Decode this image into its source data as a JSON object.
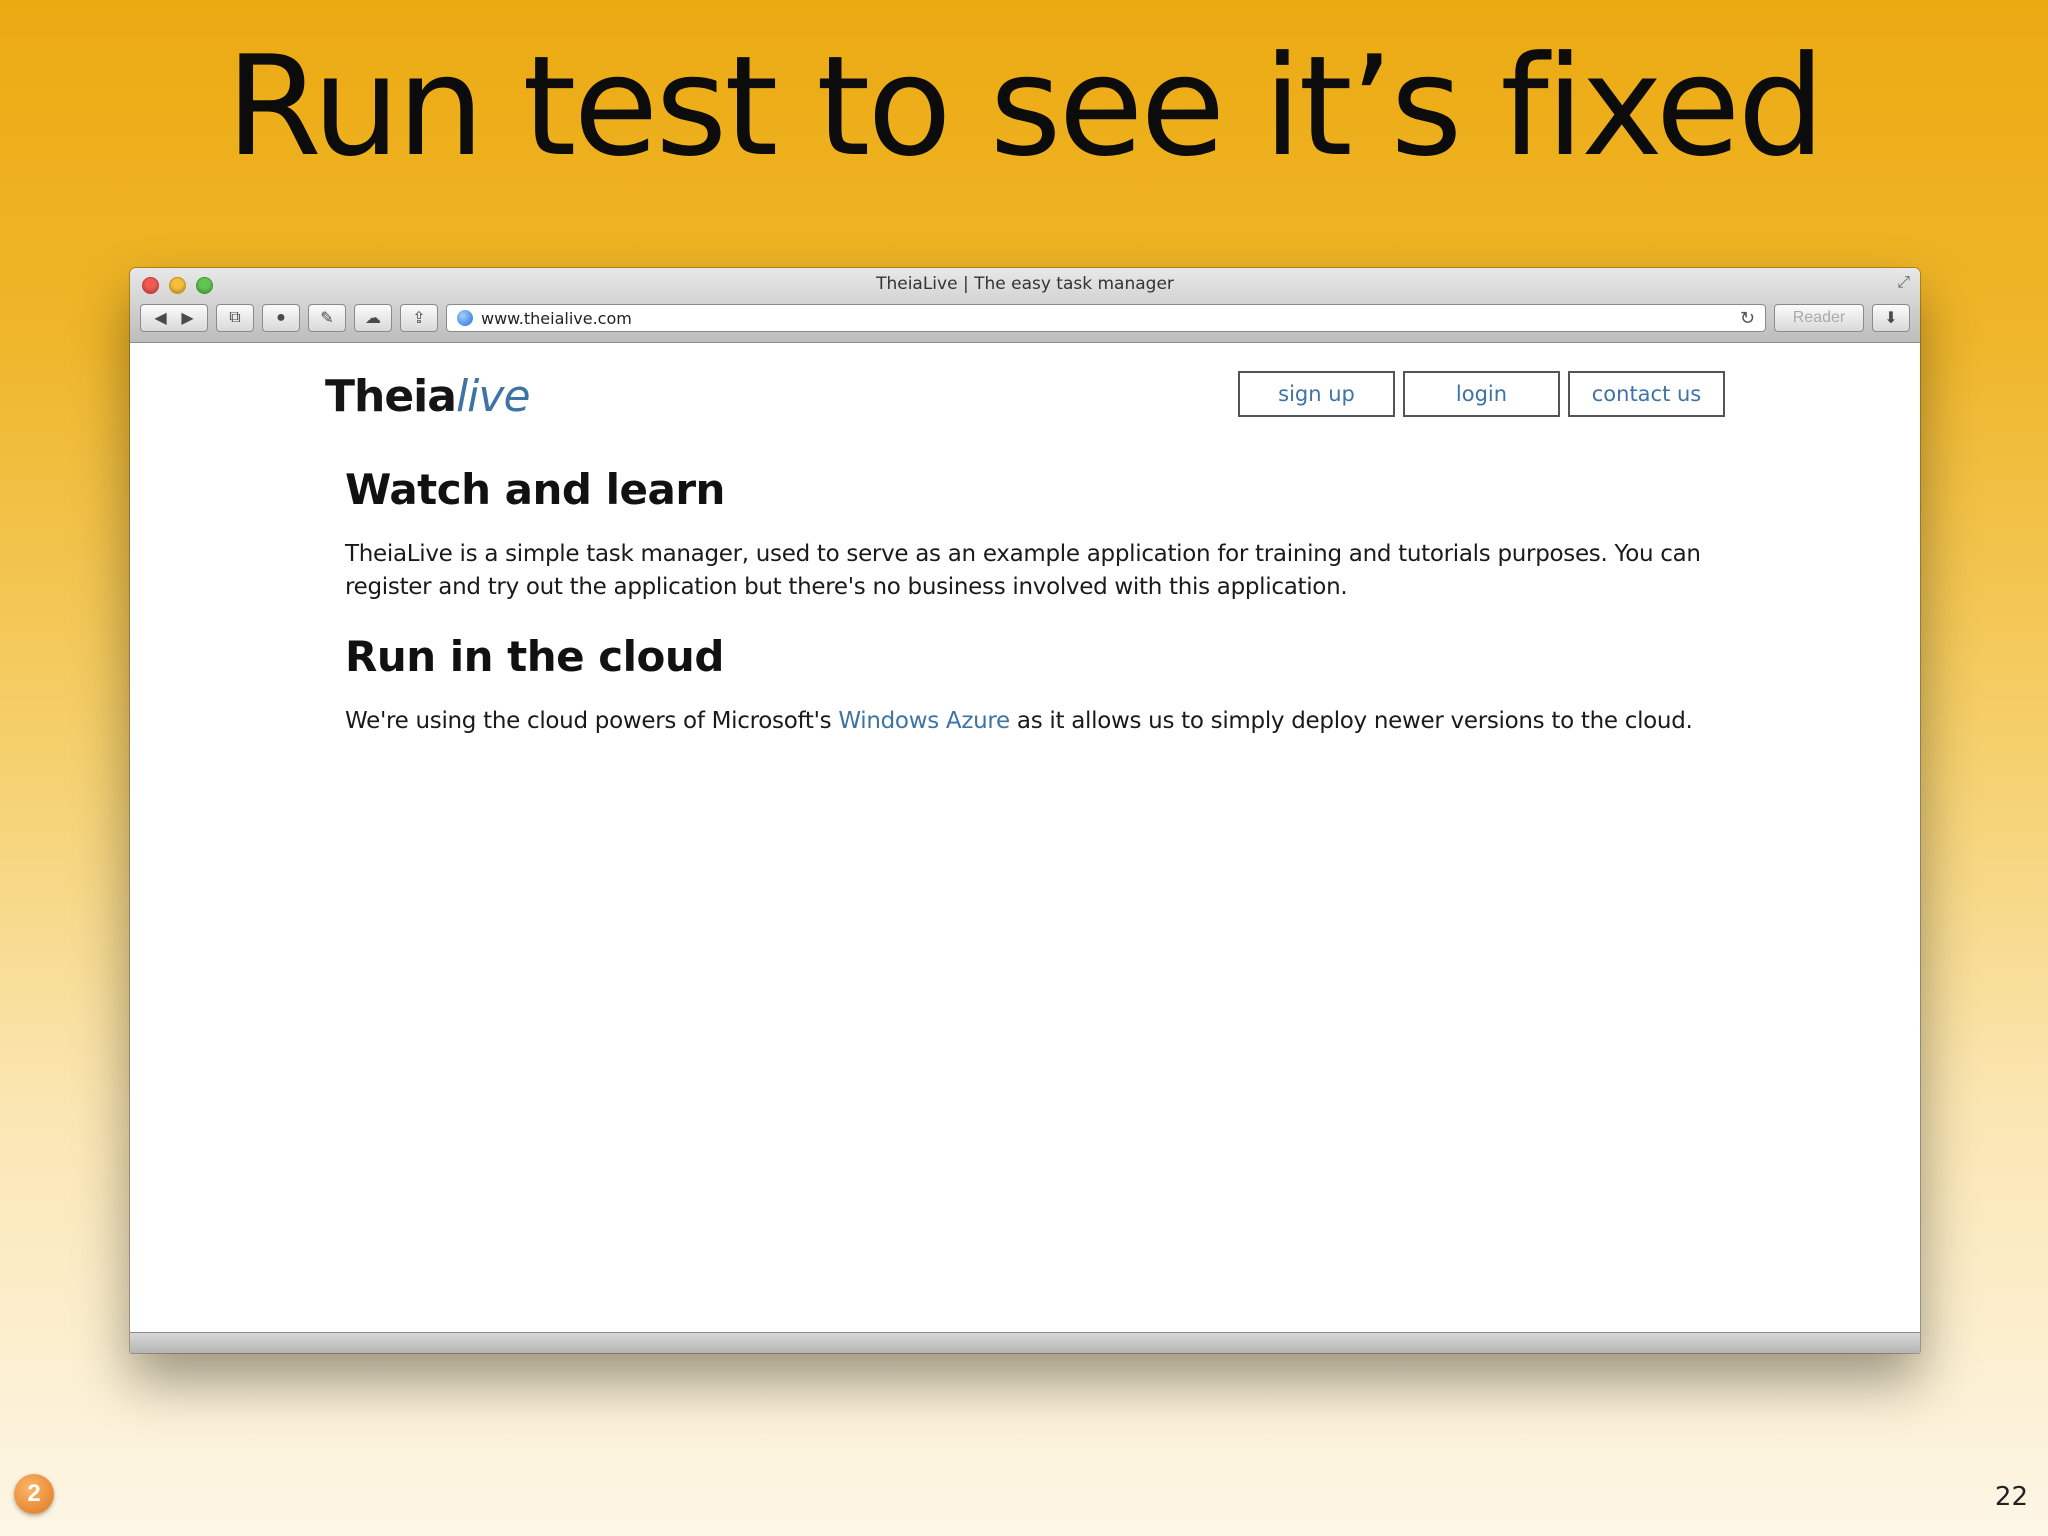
{
  "slide": {
    "title": "Run test to see it’s fixed",
    "number": "22",
    "badge_text": "2",
    "colors": {
      "background_top": "#ecaa12",
      "background_bottom": "#fdf6e6"
    }
  },
  "browser": {
    "window_title": "TheiaLive | The easy task manager",
    "address": "www.theialive.com",
    "reader_label": "Reader",
    "icons": [
      "back-icon",
      "forward-icon",
      "tabs-icon",
      "history-icon",
      "tools-icon",
      "cloud-icon",
      "share-icon",
      "globe-icon",
      "reload-icon",
      "download-icon",
      "expand-icon"
    ]
  },
  "site": {
    "logo_strong": "Theia",
    "logo_light": "live",
    "nav": {
      "signup": "sign up",
      "login": "login",
      "contact": "contact us"
    },
    "sections": [
      {
        "heading": "Watch and learn",
        "text": "TheiaLive is a simple task manager, used to serve as an example application for training and tutorials purposes. You can register and try out the application but there's no business involved with this application."
      },
      {
        "heading": "Run in the cloud",
        "text_before": "We're using the cloud powers of Microsoft's ",
        "link": "Windows Azure",
        "text_after": " as it allows us to simply deploy newer versions to the cloud."
      }
    ],
    "link_color": "#3e73a5"
  }
}
